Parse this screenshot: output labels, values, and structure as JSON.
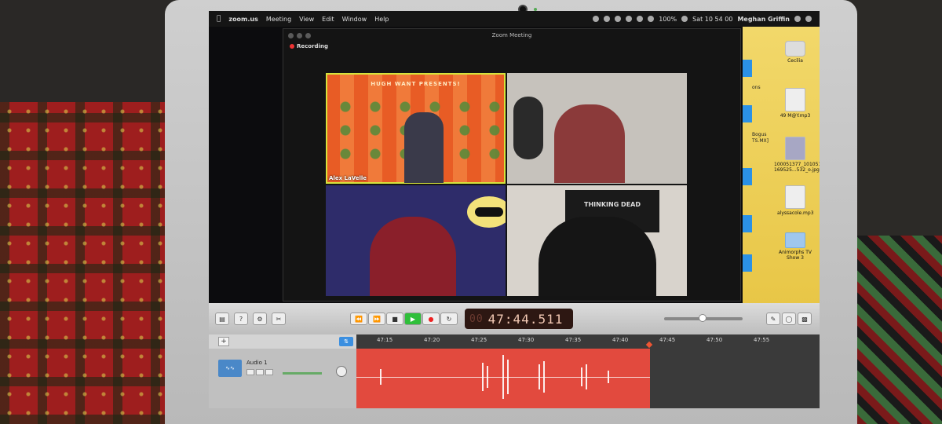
{
  "menubar": {
    "app": "zoom.us",
    "items": [
      "Meeting",
      "View",
      "Edit",
      "Window",
      "Help"
    ],
    "battery": "100%",
    "clock": "Sat 10 54 00",
    "user": "Meghan Griffin"
  },
  "zoom": {
    "title": "Zoom Meeting",
    "recording_label": "Recording",
    "participants": [
      {
        "name": "Alex LaVelle",
        "banner": "HUGH WANT PRESENTS!"
      },
      {
        "name": ""
      },
      {
        "name": ""
      },
      {
        "name": "",
        "poster": "THINKING DEAD"
      }
    ]
  },
  "desktop": {
    "items": [
      {
        "label": "Cecilia",
        "icon": "drive-icon"
      },
      {
        "label": "49 M@Y.mp3",
        "icon": "audio-file-icon"
      },
      {
        "label": "100051377_101051 169525...532_o.jpg",
        "icon": "image-file-icon"
      },
      {
        "label": "alyssacole.mp3",
        "icon": "audio-file-icon"
      },
      {
        "label": "Animorphs TV Show 3",
        "icon": "folder-icon"
      }
    ],
    "cut_labels": [
      "ons",
      "Bogus",
      "TS.MX]"
    ]
  },
  "garageband": {
    "lcd_prefix": "00",
    "lcd_time": "47:44.511",
    "ruler_ticks": [
      "47:15",
      "47:20",
      "47:25",
      "47:30",
      "47:35",
      "47:40",
      "47:45",
      "47:50",
      "47:55"
    ],
    "track_name": "Audio 1",
    "add_label": "+",
    "smart_controls": "⇅"
  }
}
